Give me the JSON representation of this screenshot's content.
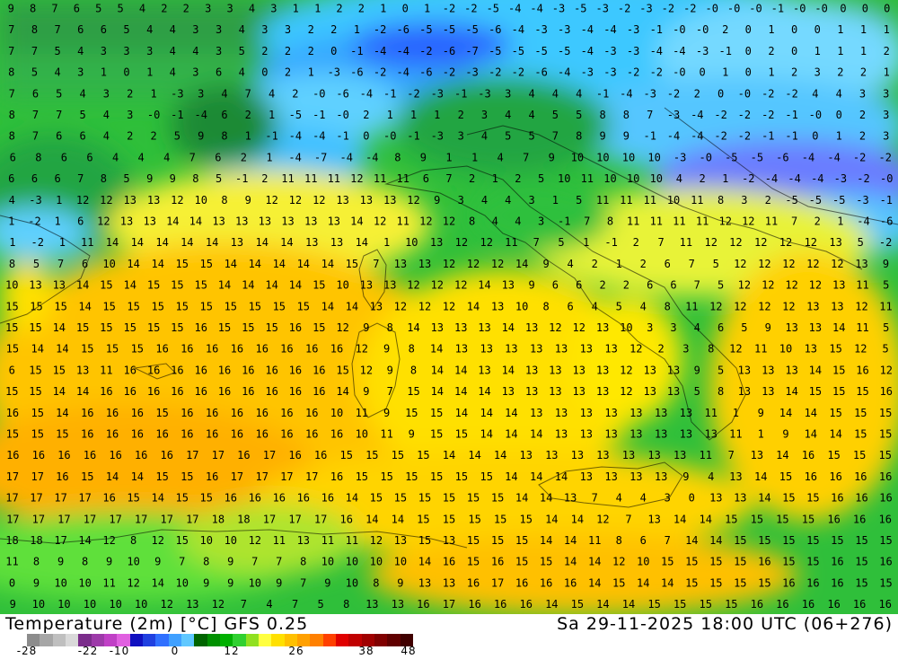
{
  "header": {
    "field": "Temperature (2m) [°C]",
    "model": "GFS 0.25",
    "valid_time": "Sa 29-11-2025 18:00 UTC (06+276)"
  },
  "legend": {
    "ticks": [
      "-28",
      "-22",
      "-10",
      "0",
      "12",
      "26",
      "38",
      "48"
    ],
    "colors": [
      "#8c8c8c",
      "#a6a6a6",
      "#bfbfbf",
      "#d9d9d9",
      "#7b2d8b",
      "#9d3aa9",
      "#c040c6",
      "#e060e0",
      "#1010c0",
      "#2040e0",
      "#3070ff",
      "#40a0ff",
      "#60c8ff",
      "#006400",
      "#009000",
      "#00b000",
      "#30d030",
      "#90e020",
      "#ffff40",
      "#ffe000",
      "#ffc000",
      "#ffa000",
      "#ff8000",
      "#ff4000",
      "#e00000",
      "#c00000",
      "#a00000",
      "#800000",
      "#600000",
      "#400000"
    ]
  },
  "map": {
    "grid_font": "monospace-style numbers",
    "rows": [
      "9 8 7 6 5 5 4 2 2 3 3 4 3 1 1 2 2 1 0 1 -2 -2 -5 -4 -4 -3 -5 -3 -2 -3 -2 -2 -0 -0 -0 -1 -0 -0 0 0 0",
      "7 8 7 6 6 5 4 4 3 3 4 3 3 2 2 1 -2 -6 -5 -5 -5 -6 -4 -3 -3 -4 -4 -3 -1 -0 -0 2 0 1 0 0 1 1 1",
      "7 7 5 4 3 3 3 4 4 3 5 2 2 2 0 -1 -4 -4 -2 -6 -7 -5 -5 -5 -5 -4 -3 -3 -4 -4 -3 -1 0 2 0 1 1 1 2",
      "8 5 4 3 1 0 1 4 3 6 4 0 2 1 -3 -6 -2 -4 -6 -2 -3 -2 -2 -6 -4 -3 -3 -2 -2 -0 0 1 0 1 2 3 2 2 1",
      "7 6 5 4 3 2 1 -3 3 4 7 4 2 -0 -6 -4 -1 -2 -3 -1 -3 3 4 4 4 -1 -4 -3 -2 2 0 -0 -2 -2 4 4 3 3",
      "8 7 7 5 4 3 -0 -1 -4 6 2 1 -5 -1 -0 2 1 1 1 2 3 4 4 5 5 8 8 7 -3 -4 -2 -2 -2 -1 -0 0 2 3",
      "8 7 6 6 4 2 2 5 9 8 1 -1 -4 -4 -1 0 -0 -1 -3 3 4 5 5 7 8 9 9 -1 -4 -4 -2 -2 -1 -1 0 1 2 3",
      "6 8 6 6 4 4 4 7 6 2 1 -4 -7 -4 -4 8 9 1 1 4 7 9 10 10 10 10 -3 -0 -5 -5 -6 -4 -4 -2 -2",
      "6 6 6 7 8 5 9 9 8 5 -1 2 11 11 11 12 11 11 6 7 2 1 2 5 10 11 10 10 10 4 2 1 -2 -4 -4 -4 -3 -2 -0",
      "4 -3 1 12 12 13 13 12 10 8 9 12 12 12 13 13 13 12 9 3 4 4 3 1 5 11 11 11 10 11 8 3 2 -5 -5 -5 -3 -1",
      "1 -2 1 6 12 13 13 14 14 13 13 13 13 13 13 14 12 11 12 12 8 4 4 3 -1 7 8 11 11 11 11 12 12 11 7 2 1 -4 -6",
      "1 -2 1 11 14 14 14 14 14 13 14 14 13 13 14 1 10 13 12 12 11 7 5 1 -1 2 7 11 12 12 12 12 12 13 5 -2",
      "8 5 7 6 10 14 14 15 15 14 14 14 14 14 15 7 13 13 12 12 12 14 9 4 2 1 2 6 7 5 12 12 12 12 12 13 9",
      "10 13 13 14 15 14 15 15 15 14 14 14 14 15 10 13 13 12 12 12 14 13 9 6 6 2 2 6 6 7 5 12 12 12 12 13 11 5",
      "15 15 15 14 15 15 15 15 15 15 15 15 15 14 14 13 12 12 12 14 13 10 8 6 4 5 4 8 11 12 12 12 12 13 13 12 11",
      "15 15 14 15 15 15 15 15 16 15 15 15 16 15 12 9 8 14 13 13 13 14 13 12 12 13 10 3 3 4 6 5 9 13 13 14 11 5",
      "15 14 14 15 15 15 16 16 16 16 16 16 16 16 12 9 8 14 13 13 13 13 13 13 13 12 2 3 8 12 11 10 13 15 12 5",
      "6 15 15 13 11 16 16 16 16 16 16 16 16 16 15 12 9 8 14 14 13 14 13 13 13 13 12 13 13 9 5 13 13 13 14 15 16 12",
      "15 15 14 14 16 16 16 16 16 16 16 16 16 16 14 9 7 15 14 14 14 13 13 13 13 13 12 13 13 5 8 13 13 14 15 15 15 16",
      "16 15 14 16 16 16 15 16 16 16 16 16 16 10 11 9 15 15 14 14 14 13 13 13 13 13 13 13 11 1 9 14 14 15 15 15",
      "15 15 15 16 16 16 16 16 16 16 16 16 16 16 10 11 9 15 15 14 14 14 13 13 13 13 13 13 13 11 1 9 14 14 15 15",
      "16 16 16 16 16 16 16 17 17 16 17 16 16 15 15 15 15 14 14 14 13 13 13 13 13 13 13 11 7 13 14 16 15 15 15",
      "17 17 16 15 14 14 15 15 16 17 17 17 17 16 15 15 15 15 15 15 14 14 14 13 13 13 13 9 4 13 14 15 16 16 16 16",
      "17 17 17 17 16 15 14 15 15 16 16 16 16 16 14 15 15 15 15 15 15 14 14 13 7 4 4 3 0 13 13 14 15 15 16 16 16",
      "17 17 17 17 17 17 17 17 18 18 17 17 17 16 14 14 15 15 15 15 15 14 14 12 7 13 14 14 15 15 15 15 16 16 16",
      "18 18 17 14 12 8 12 15 10 10 12 11 13 11 11 12 13 15 13 15 15 15 14 14 11 8 6 7 14 14 15 15 15 15 15 15 15",
      "11 8 9 8 9 10 9 7 8 9 7 7 8 10 10 10 10 14 16 15 16 15 15 14 14 12 10 15 15 15 15 16 15 15 16 15 16",
      "0 9 10 10 11 12 14 10 9 9 10 9 7 9 10 8 9 13 13 16 17 16 16 16 14 15 14 14 15 15 15 15 16 16 16 15 15",
      "9 10 10 10 10 10 12 13 12 7 4 7 5 8 13 13 16 17 16 16 16 14 15 14 14 15 15 15 15 16 16 16 16 16 16"
    ]
  }
}
